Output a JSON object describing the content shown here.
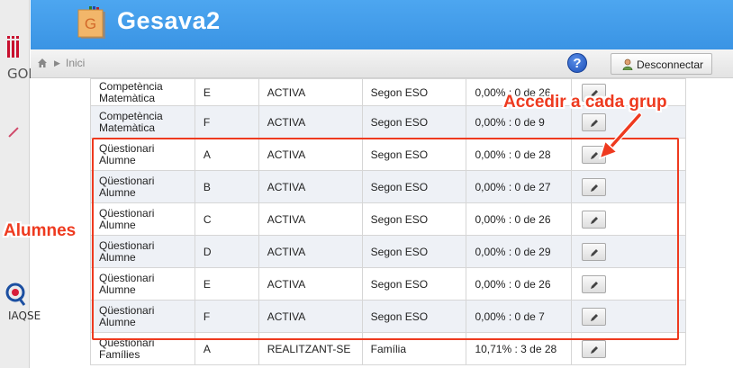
{
  "sidebar": {
    "goib_text": "GOIB",
    "iaqse_text": "IAQSE"
  },
  "header": {
    "logo_letter": "G",
    "app_title": "Gesava2"
  },
  "toolbar": {
    "breadcrumb": "Inici",
    "help_label": "?",
    "logout_label": "Desconnectar"
  },
  "table": {
    "rows": [
      {
        "name": "Competència Matemàtica",
        "group": "E",
        "state": "ACTIVA",
        "level": "Segon ESO",
        "progress": "0,00% : 0 de 26"
      },
      {
        "name": "Competència Matemàtica",
        "group": "F",
        "state": "ACTIVA",
        "level": "Segon ESO",
        "progress": "0,00% : 0 de 9"
      },
      {
        "name": "Qüestionari Alumne",
        "group": "A",
        "state": "ACTIVA",
        "level": "Segon ESO",
        "progress": "0,00% : 0 de 28"
      },
      {
        "name": "Qüestionari Alumne",
        "group": "B",
        "state": "ACTIVA",
        "level": "Segon ESO",
        "progress": "0,00% : 0 de 27"
      },
      {
        "name": "Qüestionari Alumne",
        "group": "C",
        "state": "ACTIVA",
        "level": "Segon ESO",
        "progress": "0,00% : 0 de 26"
      },
      {
        "name": "Qüestionari Alumne",
        "group": "D",
        "state": "ACTIVA",
        "level": "Segon ESO",
        "progress": "0,00% : 0 de 29"
      },
      {
        "name": "Qüestionari Alumne",
        "group": "E",
        "state": "ACTIVA",
        "level": "Segon ESO",
        "progress": "0,00% : 0 de 26"
      },
      {
        "name": "Qüestionari Alumne",
        "group": "F",
        "state": "ACTIVA",
        "level": "Segon ESO",
        "progress": "0,00% : 0 de 7"
      },
      {
        "name": "Qüestionari Famílies",
        "group": "A",
        "state": "REALITZANT-SE",
        "level": "Família",
        "progress": "10,71% : 3 de 28"
      }
    ]
  },
  "annotations": {
    "alumnes": "Alumnes",
    "accedir": "Accedir a cada grup",
    "color": "#ee3a1f"
  },
  "colors": {
    "header_blue": "#3a94e4",
    "row_alt": "#eef1f6"
  }
}
